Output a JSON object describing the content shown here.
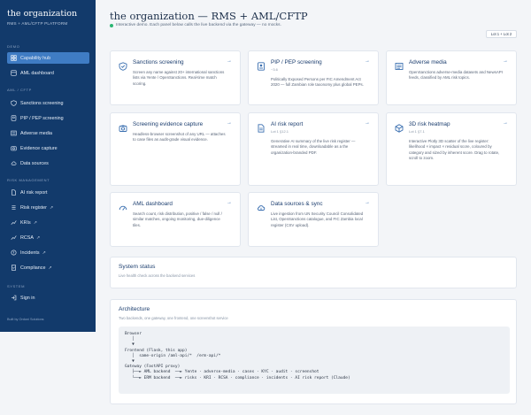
{
  "brand": {
    "title": "the organization",
    "subtitle": "RMS + AML/CFTP PLATFORM"
  },
  "sidebar": {
    "sections": {
      "demo": "DEMO",
      "aml": "AML / CFTP",
      "risk": "RISK MANAGEMENT",
      "system": "SYSTEM"
    },
    "items": [
      {
        "label": "Capability hub",
        "icon": "grid-icon"
      },
      {
        "label": "AML dashboard",
        "icon": "dashboard-icon"
      },
      {
        "label": "Sanctions screening",
        "icon": "shield-icon"
      },
      {
        "label": "PIP / PEP screening",
        "icon": "id-card-icon"
      },
      {
        "label": "Adverse media",
        "icon": "newspaper-icon"
      },
      {
        "label": "Evidence capture",
        "icon": "camera-icon"
      },
      {
        "label": "Data sources",
        "icon": "cloud-icon"
      },
      {
        "label": "AI risk report",
        "icon": "document-icon"
      },
      {
        "label": "Risk register",
        "icon": "list-icon",
        "external": "↗"
      },
      {
        "label": "KRIs",
        "icon": "chart-icon",
        "external": "↗"
      },
      {
        "label": "RCSA",
        "icon": "chart-icon",
        "external": "↗"
      },
      {
        "label": "Incidents",
        "icon": "alert-icon",
        "external": "↗"
      },
      {
        "label": "Compliance",
        "icon": "check-doc-icon",
        "external": "↗"
      },
      {
        "label": "Sign in",
        "icon": "sign-in-icon"
      }
    ],
    "footer": "Built by Ordoni Solutions"
  },
  "header": {
    "title": "the organization — RMS + AML/CFTP",
    "subtitle": "Interactive demo. Each panel below calls the live backend via the gateway — no mocks.",
    "lot_badge": "Lot 1 + Lot 2",
    "status_color": "#2bb673"
  },
  "cards": [
    {
      "title": "Sanctions screening",
      "meta": "",
      "icon": "shield-icon",
      "desc": "Screen any name against 20+ international sanctions lists via Yente / OpenSanctions. Real-time match scoring."
    },
    {
      "title": "PIP / PEP screening",
      "meta": "~3.6",
      "icon": "id-card-icon",
      "desc": "Politically Exposed Persons per FIC Amendment Act 2020 — full Zambian role taxonomy plus global PEPs."
    },
    {
      "title": "Adverse media",
      "meta": "",
      "icon": "newspaper-icon",
      "desc": "OpenSanctions adverse-media datasets and NewsAPI feeds, classified by AML risk topics."
    },
    {
      "title": "Screening evidence capture",
      "meta": "",
      "icon": "camera-icon",
      "desc": "Headless-browser screenshot of any URL — attaches to case files as audit-grade visual evidence."
    },
    {
      "title": "AI risk report",
      "meta": "Lot 1 §12.1",
      "icon": "document-icon",
      "desc": "Generative AI summary of the live risk register — streamed in real time, downloadable as a the organization-branded PDF."
    },
    {
      "title": "3D risk heatmap",
      "meta": "Lot 1 §7.1",
      "icon": "cube-icon",
      "desc": "Interactive Plotly 3D scatter of the live register: likelihood × impact × residual score, coloured by category and sized by inherent score. Drag to rotate, scroll to zoom."
    },
    {
      "title": "AML dashboard",
      "meta": "",
      "icon": "dashboard-icon",
      "desc": "Search count, risk distribution, positive / false / null / similar matches, ongoing monitoring, due-diligence tiles."
    },
    {
      "title": "Data sources & sync",
      "meta": "",
      "icon": "cloud-icon",
      "desc": "Live ingestion from UN Security Council Consolidated List, OpenSanctions catalogue, and FIC Zambia local register (CSV upload)."
    }
  ],
  "card_arrow": "→",
  "system_status": {
    "title": "System status",
    "subtitle": "Live health check across the backend services"
  },
  "architecture": {
    "title": "Architecture",
    "subtitle": "Two backends, one gateway, one frontend, one screenshot service",
    "diagram": "Browser\n   │\n   ▼\nFrontend (Flask, this app)\n   │  same-origin /aml-api/*  /erm-api/*\n   ▼\nGateway (FastAPI proxy)\n   ├──► AML backend  ──► Yente · adverse-media · cases · KYC · audit · screenshot\n   └──► ERM backend  ──► risks · KRI · RCSA · compliance · incidents · AI risk report (Claude)"
  }
}
